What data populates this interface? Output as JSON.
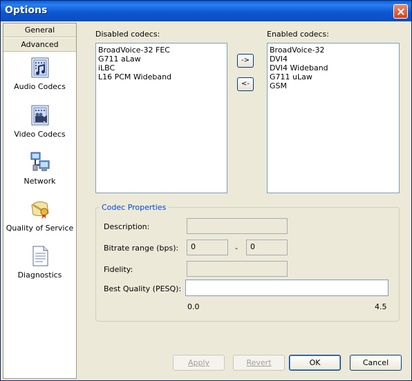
{
  "window": {
    "title": "Options"
  },
  "sidebar": {
    "tabs": [
      "General",
      "Advanced"
    ],
    "items": [
      {
        "label": "Audio Codecs",
        "icon": "audio-codecs-icon"
      },
      {
        "label": "Video Codecs",
        "icon": "video-codecs-icon"
      },
      {
        "label": "Network",
        "icon": "network-icon"
      },
      {
        "label": "Quality of Service",
        "icon": "quality-of-service-icon"
      },
      {
        "label": "Diagnostics",
        "icon": "diagnostics-icon"
      }
    ]
  },
  "codecs": {
    "disabled_label": "Disabled codecs:",
    "enabled_label": "Enabled codecs:",
    "disabled": [
      "BroadVoice-32 FEC",
      "G711 aLaw",
      "iLBC",
      "L16 PCM Wideband"
    ],
    "enabled": [
      "BroadVoice-32",
      "DVI4",
      "DVI4 Wideband",
      "G711 uLaw",
      "GSM"
    ],
    "move_right_label": "->",
    "move_left_label": "<-"
  },
  "properties": {
    "legend": "Codec Properties",
    "description_label": "Description:",
    "description_value": "",
    "bitrate_label": "Bitrate range (bps):",
    "bitrate_min": "0",
    "bitrate_sep": "-",
    "bitrate_max": "0",
    "fidelity_label": "Fidelity:",
    "fidelity_value": "",
    "best_quality_label": "Best Quality (PESQ):",
    "best_quality_value": "",
    "scale_min": "0.0",
    "scale_max": "4.5"
  },
  "buttons": {
    "apply": "Apply",
    "revert": "Revert",
    "ok": "OK",
    "cancel": "Cancel"
  },
  "colors": {
    "titlebar": "#0a5fd6",
    "accent": "#0046d5"
  }
}
